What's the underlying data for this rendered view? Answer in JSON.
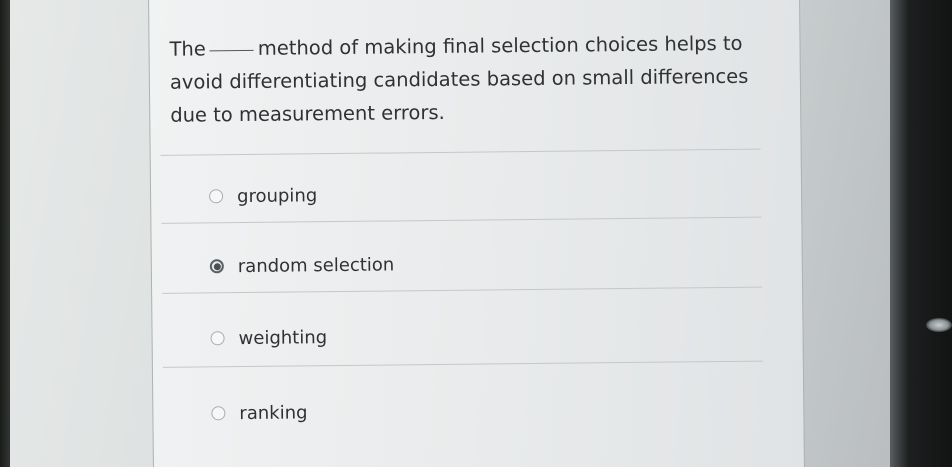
{
  "question": {
    "before_blank": "The",
    "after_blank": "method of making final selection choices helps to avoid differentiating candidates based on small differences due to measurement errors."
  },
  "options": [
    {
      "label": "grouping",
      "selected": false
    },
    {
      "label": "random selection",
      "selected": true
    },
    {
      "label": "weighting",
      "selected": false
    },
    {
      "label": "ranking",
      "selected": false
    }
  ]
}
